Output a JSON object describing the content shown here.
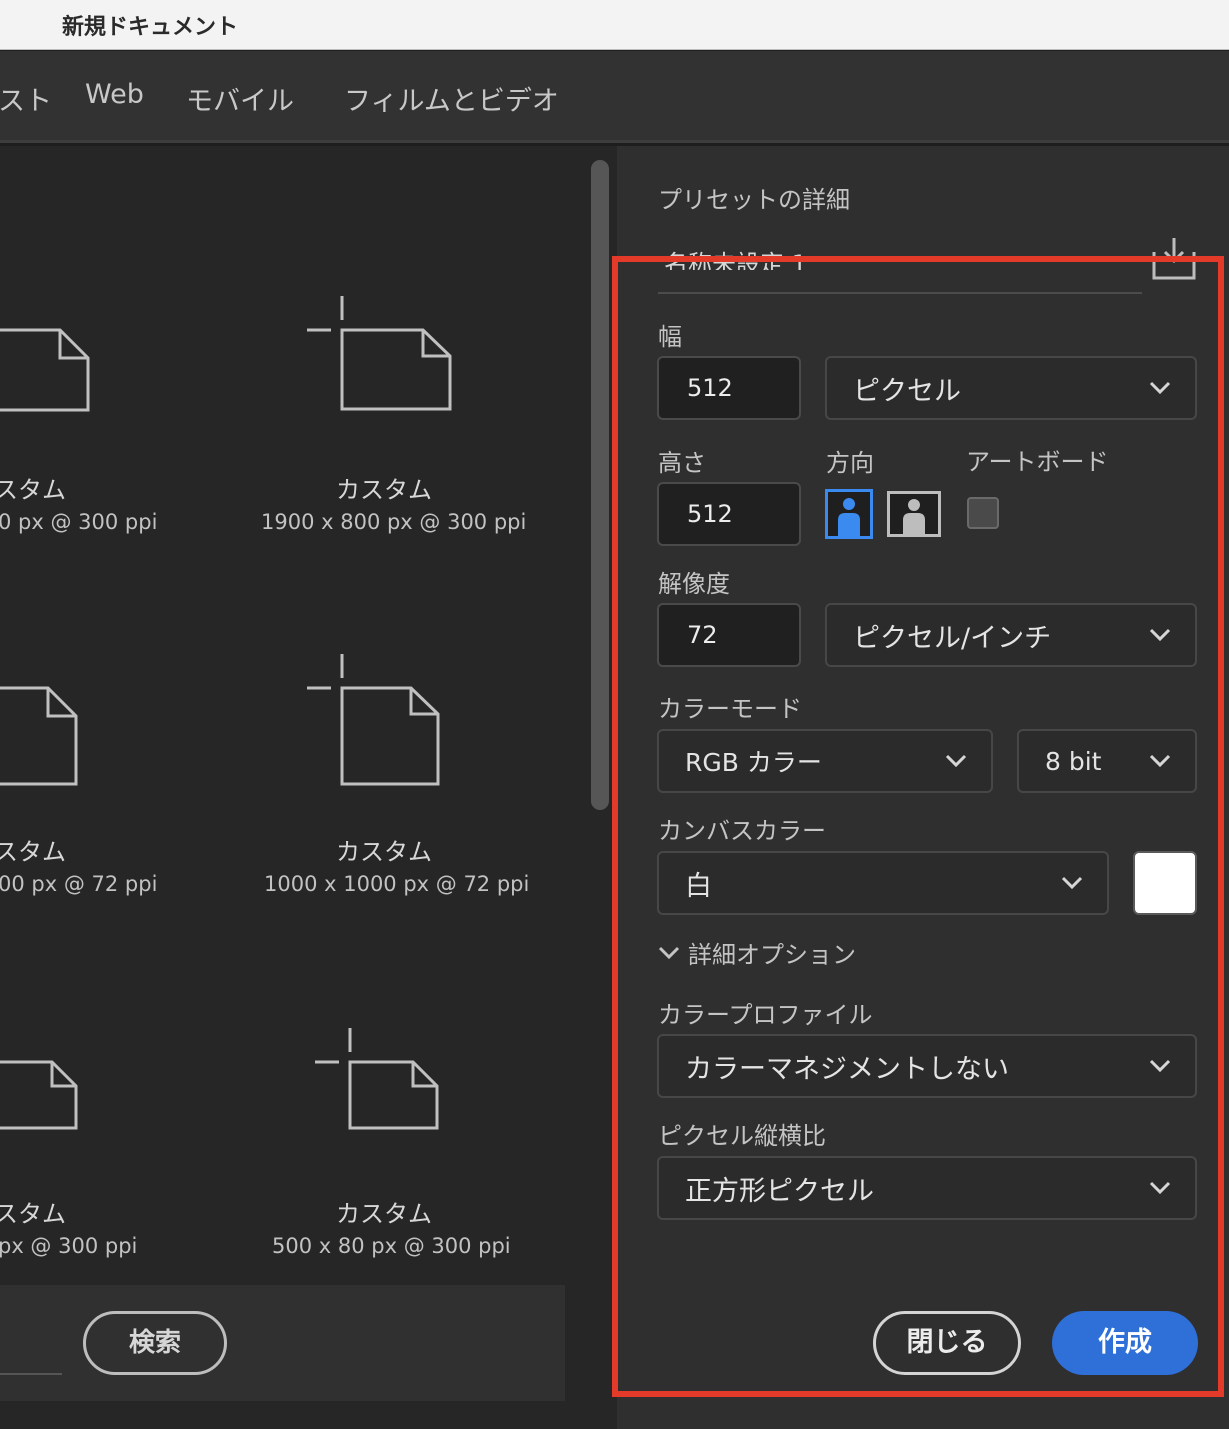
{
  "window": {
    "title": "新規ドキュメント"
  },
  "tabs": [
    {
      "label": "スト"
    },
    {
      "label": "Web"
    },
    {
      "label": "モバイル"
    },
    {
      "label": "フィルムとビデオ"
    }
  ],
  "presets": [
    {
      "name": "スタム",
      "size": "0 px @ 300 ppi"
    },
    {
      "name": "カスタム",
      "size": "1900 x 800 px @ 300 ppi"
    },
    {
      "name": "スタム",
      "size": "00 px @ 72 ppi"
    },
    {
      "name": "カスタム",
      "size": "1000 x 1000 px @ 72 ppi"
    },
    {
      "name": "スタム",
      "size": "px @ 300 ppi"
    },
    {
      "name": "カスタム",
      "size": "500 x 80 px @ 300 ppi"
    }
  ],
  "search": {
    "button_label": "検索"
  },
  "details": {
    "section_title": "プリセットの詳細",
    "preset_name": "名称未設定 1",
    "width": {
      "label": "幅",
      "value": "512",
      "unit": "ピクセル"
    },
    "height": {
      "label": "高さ",
      "value": "512"
    },
    "orientation": {
      "label": "方向",
      "selected": "portrait"
    },
    "artboard": {
      "label": "アートボード",
      "checked": false
    },
    "resolution": {
      "label": "解像度",
      "value": "72",
      "unit": "ピクセル/インチ"
    },
    "color_mode": {
      "label": "カラーモード",
      "mode": "RGB カラー",
      "depth": "8 bit"
    },
    "canvas_color": {
      "label": "カンバスカラー",
      "value": "白",
      "swatch": "#ffffff"
    },
    "advanced": {
      "label": "詳細オプション",
      "expanded": true
    },
    "color_profile": {
      "label": "カラープロファイル",
      "value": "カラーマネジメントしない"
    },
    "pixel_aspect": {
      "label": "ピクセル縦横比",
      "value": "正方形ピクセル"
    }
  },
  "footer": {
    "close_label": "閉じる",
    "create_label": "作成"
  },
  "colors": {
    "accent": "#2f6fd8",
    "highlight": "#e43a2a"
  }
}
